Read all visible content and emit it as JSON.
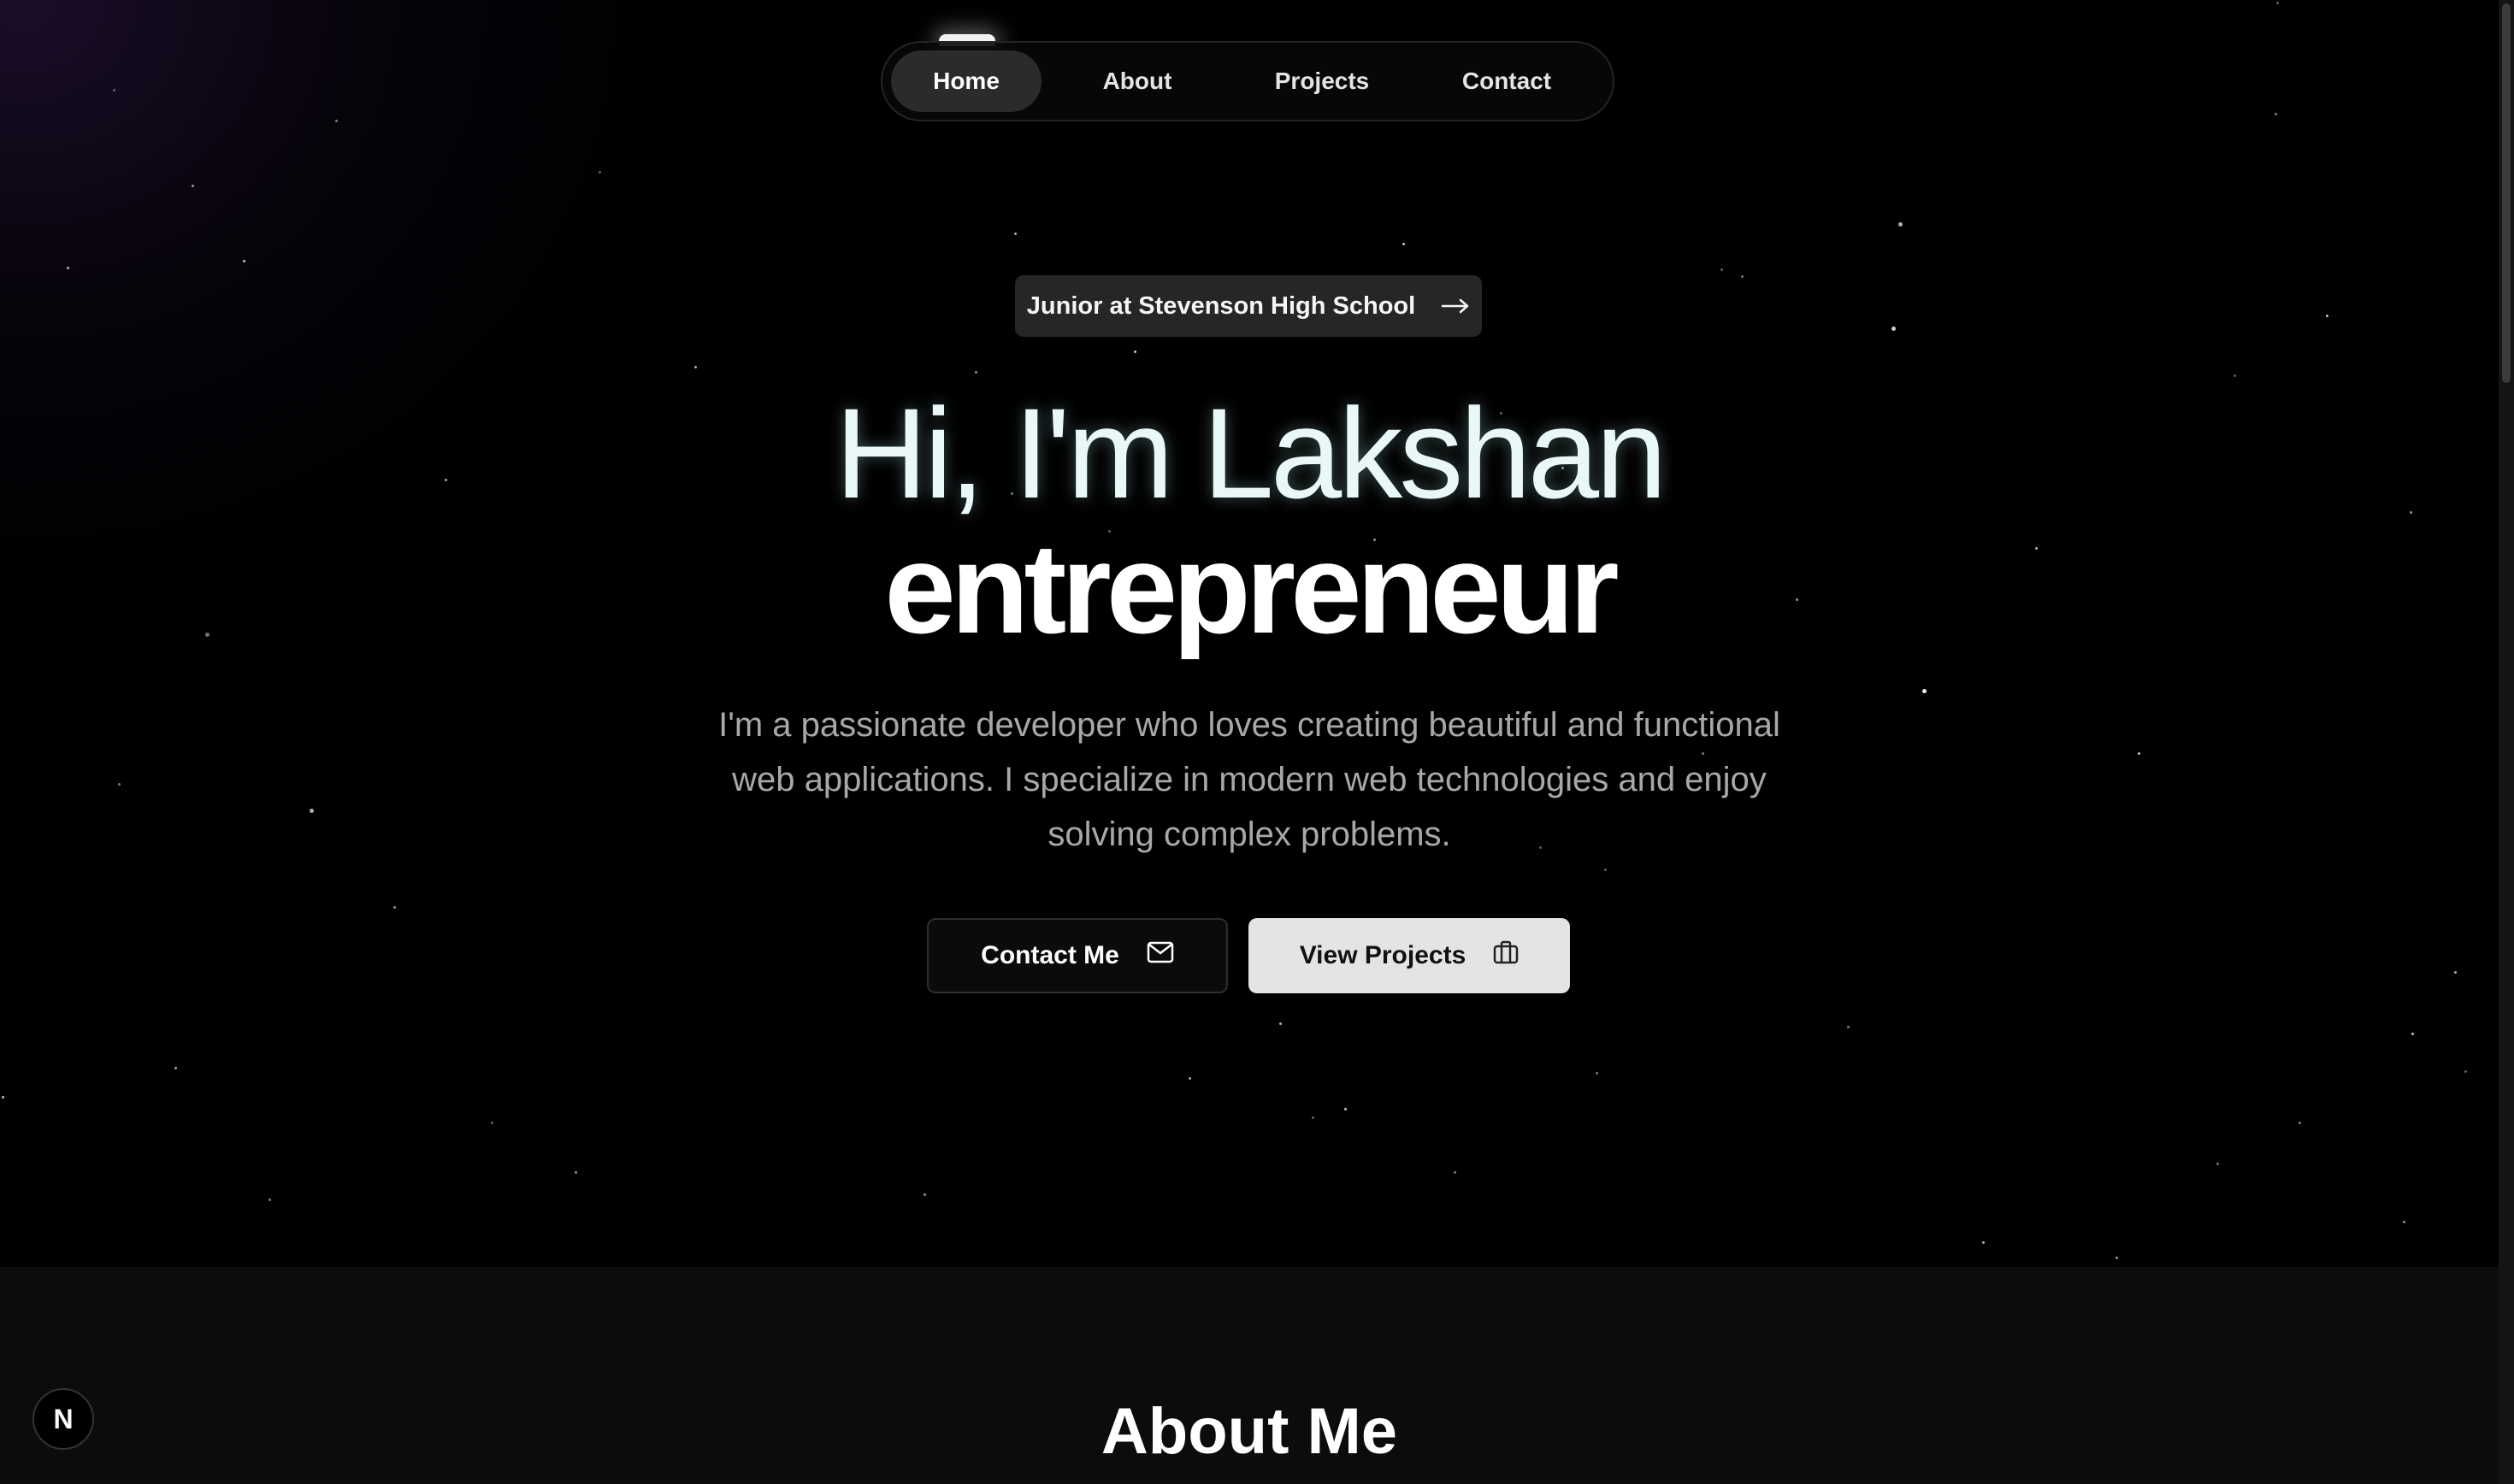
{
  "nav": {
    "items": [
      {
        "label": "Home",
        "active": true
      },
      {
        "label": "About",
        "active": false
      },
      {
        "label": "Projects",
        "active": false
      },
      {
        "label": "Contact",
        "active": false
      }
    ]
  },
  "hero": {
    "badge_text": "Junior at Stevenson High School",
    "badge_icon": "arrow-right-icon",
    "greeting": "Hi, I'm Lakshan",
    "role": "entrepreneur",
    "intro": "I'm a passionate developer who loves creating beautiful and functional web applications. I specialize in modern web technologies and enjoy solving complex problems.",
    "buttons": {
      "contact_label": "Contact Me",
      "contact_icon": "mail-icon",
      "projects_label": "View Projects",
      "projects_icon": "briefcase-icon"
    }
  },
  "about": {
    "title": "About Me"
  },
  "dev_badge": {
    "label": "N",
    "icon": "nextjs-logo-icon"
  },
  "colors": {
    "background": "#000000",
    "section_bg": "#0c0c0c",
    "nav_active_bg": "#2b2b2b",
    "badge_bg": "#262626",
    "primary_button_bg": "#e4e4e4",
    "muted_text": "#a8a8a8",
    "headline_tint": "#eaf7f7"
  }
}
